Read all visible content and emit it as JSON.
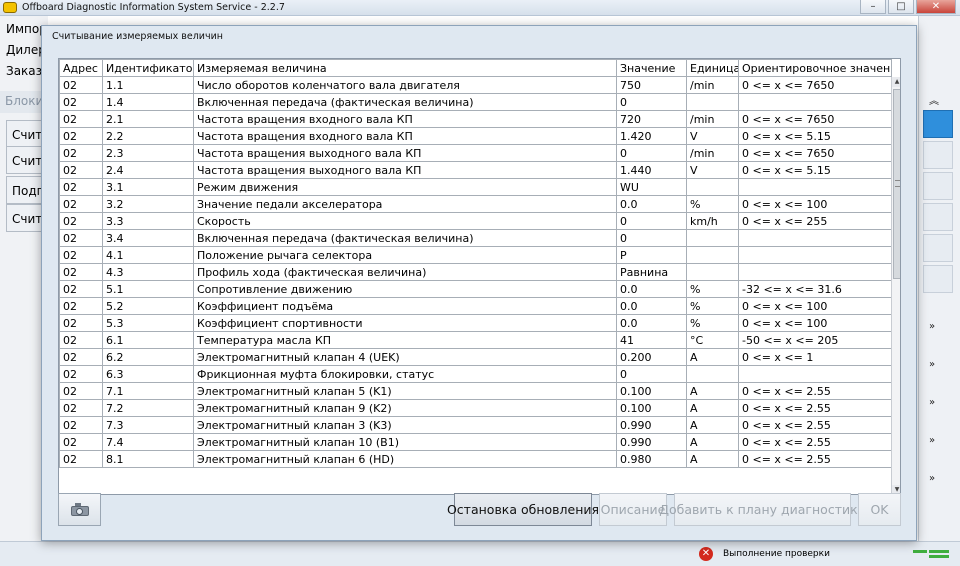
{
  "app": {
    "title": "Offboard Diagnostic Information System Service - 2.2.7",
    "window_buttons": {
      "minimize": "–",
      "maximize": "□",
      "close": "✕"
    }
  },
  "left_panel": {
    "labels": [
      "Импор",
      "Дилер",
      "Заказ:"
    ],
    "blocks_label": "Блоки",
    "items": [
      "Счита",
      "Счита",
      "Подго",
      "Счита"
    ]
  },
  "right_panel": {
    "chevrons": [
      "»",
      "»",
      "»",
      "»",
      "»",
      "»"
    ]
  },
  "status_bar": {
    "error_icon": "✕",
    "text": "Выполнение проверки"
  },
  "dialog": {
    "title": "Считывание измеряемых величин",
    "columns": [
      "Адрес",
      "Идентификатор",
      "Измеряемая величина",
      "Значение",
      "Единица",
      "Ориентировочное значение"
    ],
    "rows": [
      [
        "02",
        "1.1",
        "Число оборотов коленчатого вала двигателя",
        "750",
        "/min",
        "0 <= x <= 7650"
      ],
      [
        "02",
        "1.4",
        "Включенная передача (фактическая величина)",
        "0",
        "",
        ""
      ],
      [
        "02",
        "2.1",
        "Частота вращения входного вала КП",
        "720",
        "/min",
        "0 <= x <= 7650"
      ],
      [
        "02",
        "2.2",
        "Частота вращения входного вала КП",
        "1.420",
        "V",
        "0 <= x <= 5.15"
      ],
      [
        "02",
        "2.3",
        "Частота вращения выходного вала КП",
        "0",
        "/min",
        "0 <= x <= 7650"
      ],
      [
        "02",
        "2.4",
        "Частота вращения выходного вала КП",
        "1.440",
        "V",
        "0 <= x <= 5.15"
      ],
      [
        "02",
        "3.1",
        "Режим движения",
        "WU",
        "",
        ""
      ],
      [
        "02",
        "3.2",
        "Значение педали акселератора",
        "0.0",
        "%",
        "0 <= x <= 100"
      ],
      [
        "02",
        "3.3",
        "Скорость",
        "0",
        "km/h",
        "0 <= x <= 255"
      ],
      [
        "02",
        "3.4",
        "Включенная передача (фактическая величина)",
        "0",
        "",
        ""
      ],
      [
        "02",
        "4.1",
        "Положение рычага селектора",
        "P",
        "",
        ""
      ],
      [
        "02",
        "4.3",
        "Профиль хода (фактическая величина)",
        "Равнина",
        "",
        ""
      ],
      [
        "02",
        "5.1",
        "Сопротивление движению",
        "0.0",
        "%",
        "-32 <= x <= 31.6"
      ],
      [
        "02",
        "5.2",
        "Коэффициент подъёма",
        "0.0",
        "%",
        "0 <= x <= 100"
      ],
      [
        "02",
        "5.3",
        "Коэффициент спортивности",
        "0.0",
        "%",
        "0 <= x <= 100"
      ],
      [
        "02",
        "6.1",
        "Температура масла КП",
        "41",
        "°C",
        "-50 <= x <= 205"
      ],
      [
        "02",
        "6.2",
        "Электромагнитный клапан 4 (UEK)",
        "0.200",
        "A",
        "0 <= x <= 1"
      ],
      [
        "02",
        "6.3",
        "Фрикционная муфта блокировки, статус",
        " 0",
        "",
        ""
      ],
      [
        "02",
        "7.1",
        "Электромагнитный клапан 5 (K1)",
        "0.100",
        "A",
        "0 <= x <= 2.55"
      ],
      [
        "02",
        "7.2",
        "Электромагнитный клапан 9 (K2)",
        "0.100",
        "A",
        "0 <= x <= 2.55"
      ],
      [
        "02",
        "7.3",
        "Электромагнитный клапан 3 (K3)",
        "0.990",
        "A",
        "0 <= x <= 2.55"
      ],
      [
        "02",
        "7.4",
        "Электромагнитный клапан 10 (B1)",
        "0.990",
        "A",
        "0 <= x <= 2.55"
      ],
      [
        "02",
        "8.1",
        "Электромагнитный клапан 6 (HD)",
        "0.980",
        "A",
        "0 <= x <= 2.55"
      ]
    ],
    "buttons": {
      "stop_update": "Остановка обновления",
      "description": "Описание",
      "add_to_plan": "Добавить к плану диагностики",
      "ok": "OK"
    }
  }
}
